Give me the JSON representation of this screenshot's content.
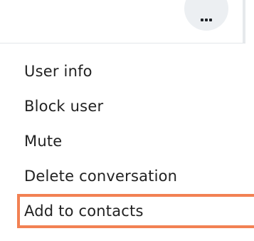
{
  "header": {
    "more_icon": "more-horizontal-icon"
  },
  "menu": {
    "items": [
      {
        "label": "User info"
      },
      {
        "label": "Block user"
      },
      {
        "label": "Mute"
      },
      {
        "label": "Delete conversation"
      },
      {
        "label": "Add to contacts"
      }
    ],
    "highlight_color": "#f28153"
  },
  "colors": {
    "text": "#222222",
    "button_bg": "#eceff2",
    "divider": "#e3e7ea"
  }
}
